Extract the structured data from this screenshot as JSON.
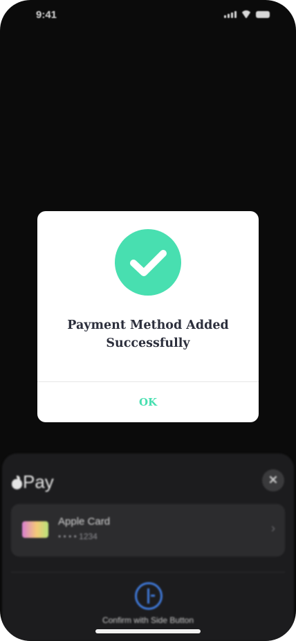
{
  "status_bar": {
    "time": "9:41",
    "icons": [
      "cellular-signal-icon",
      "wifi-icon",
      "battery-icon"
    ]
  },
  "dialog": {
    "icon": "checkmark-circle-icon",
    "title_line1": "Payment Method Added",
    "title_line2": "Successfully",
    "ok_label": "OK"
  },
  "apple_pay": {
    "logo_text": "Pay",
    "close_icon": "✕",
    "card": {
      "name": "Apple Card",
      "number": "• • • • 1234",
      "chevron": "›"
    },
    "confirm_text": "Confirm with Side Button"
  },
  "colors": {
    "accent": "#48dfb0",
    "title": "#2c2f3c",
    "background": "#0b0b0b",
    "sheet": "#1c1c1e",
    "side_button_blue": "#3f79d9"
  }
}
